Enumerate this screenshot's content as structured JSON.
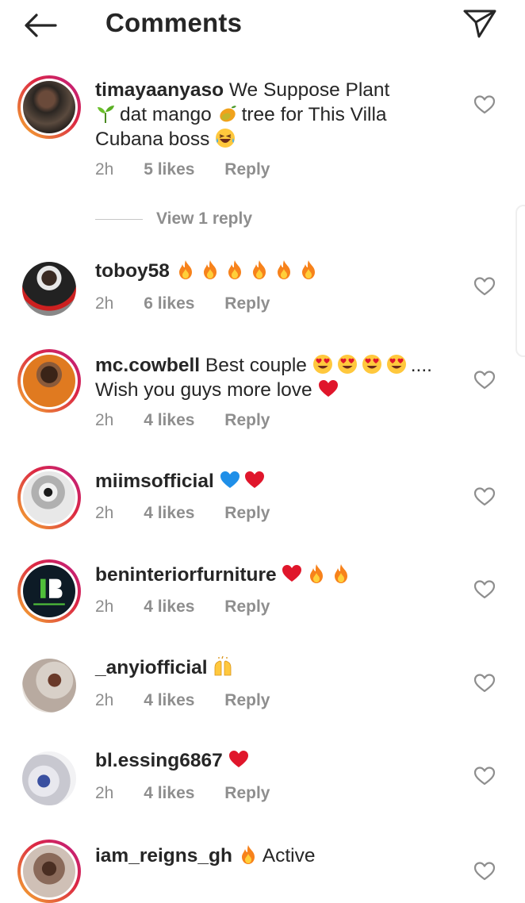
{
  "header": {
    "title": "Comments",
    "back_icon": "back-arrow-icon",
    "share_icon": "paper-plane-icon"
  },
  "comments": [
    {
      "username": "timayaanyaso",
      "line1": "We Suppose Plant",
      "line2": "dat mango",
      "line2b": "tree for This Villa",
      "line3": "Cubana boss",
      "time": "2h",
      "likes": "5 likes",
      "reply": "Reply",
      "emojis": [
        "seedling-emoji",
        "mango-emoji",
        "laughing-emoji"
      ]
    },
    {
      "username": "toboy58",
      "time": "2h",
      "likes": "6 likes",
      "reply": "Reply",
      "emojis": [
        "fire-emoji",
        "fire-emoji",
        "fire-emoji",
        "fire-emoji",
        "fire-emoji",
        "fire-emoji"
      ]
    },
    {
      "username": "mc.cowbell",
      "line1": "Best couple",
      "line1b": "....",
      "line2": "Wish you guys more love",
      "time": "2h",
      "likes": "4 likes",
      "reply": "Reply",
      "emojis": [
        "heart-eyes-emoji",
        "heart-eyes-emoji",
        "heart-eyes-emoji",
        "heart-eyes-emoji",
        "red-heart-emoji"
      ]
    },
    {
      "username": "miimsofficial",
      "time": "2h",
      "likes": "4 likes",
      "reply": "Reply",
      "emojis": [
        "blue-heart-emoji",
        "red-heart-emoji"
      ]
    },
    {
      "username": "beninteriorfurniture",
      "time": "2h",
      "likes": "4 likes",
      "reply": "Reply",
      "emojis": [
        "red-heart-emoji",
        "fire-emoji",
        "fire-emoji"
      ]
    },
    {
      "username": "_anyiofficial",
      "time": "2h",
      "likes": "4 likes",
      "reply": "Reply",
      "emojis": [
        "raised-hands-emoji"
      ]
    },
    {
      "username": "bl.essing6867",
      "time": "2h",
      "likes": "4 likes",
      "reply": "Reply",
      "emojis": [
        "red-heart-emoji"
      ]
    },
    {
      "username": "iam_reigns_gh",
      "line1": "Active",
      "emojis": [
        "fire-emoji"
      ]
    }
  ],
  "view_replies": "View 1 reply",
  "colors": {
    "text": "#262626",
    "muted": "#8e8e8e",
    "heart_red": "#e0162b",
    "fire": "#f7821b"
  }
}
